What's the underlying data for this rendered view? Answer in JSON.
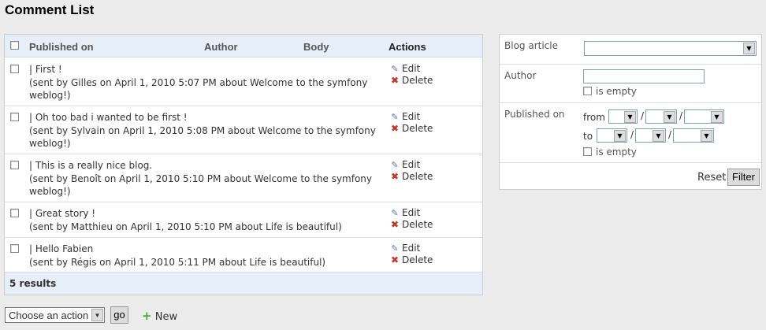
{
  "page_title": "Comment List",
  "table": {
    "headers": {
      "published_on": "Published on",
      "author": "Author",
      "body": "Body",
      "actions": "Actions"
    },
    "rows": [
      {
        "line1": "| First !",
        "line2": "(sent by Gilles on April 1, 2010 5:07 PM about Welcome to the symfony weblog!)"
      },
      {
        "line1": "| Oh too bad i wanted to be first !",
        "line2": "(sent by Sylvain on April 1, 2010 5:08 PM about Welcome to the symfony weblog!)"
      },
      {
        "line1": "| This is a really nice blog.",
        "line2": "(sent by Benoît on April 1, 2010 5:10 PM about Welcome to the symfony weblog!)"
      },
      {
        "line1": "| Great story !",
        "line2": "(sent by Matthieu on April 1, 2010 5:10 PM about Life is beautiful)"
      },
      {
        "line1": "| Hello Fabien",
        "line2": "(sent by Régis on April 1, 2010 5:11 PM about Life is beautiful)"
      }
    ],
    "edit_label": "Edit",
    "delete_label": "Delete",
    "results": "5 results"
  },
  "filters": {
    "blog_article_label": "Blog article",
    "author_label": "Author",
    "is_empty_label": "is empty",
    "published_on_label": "Published on",
    "from_label": "from",
    "to_label": "to",
    "date_sep": "/",
    "reset_label": "Reset",
    "filter_label": "Filter"
  },
  "batch": {
    "action_select_value": "Choose an action",
    "go_label": "go",
    "new_label": "New"
  },
  "icons": {
    "edit": "pencil-icon",
    "delete": "cross-icon",
    "new": "plus-icon",
    "select": "chevron-down-icon"
  }
}
